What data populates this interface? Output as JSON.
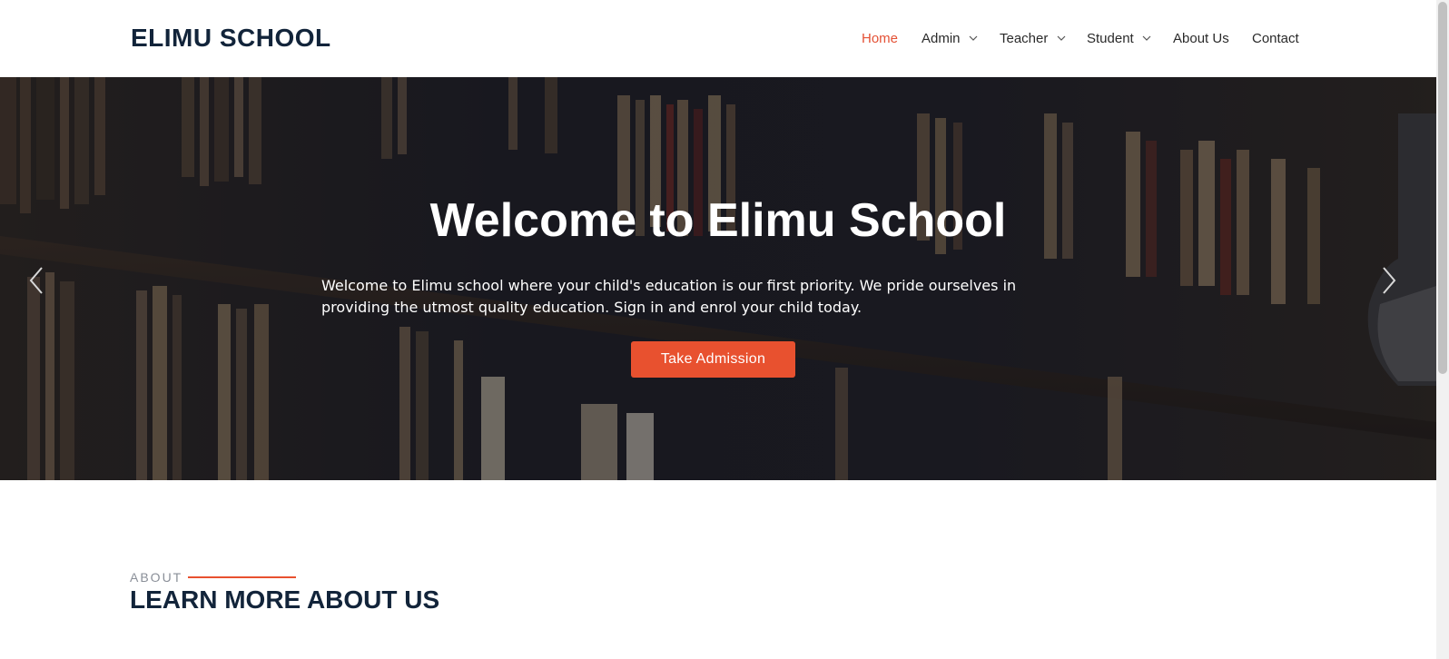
{
  "brand": {
    "name": "ELIMU SCHOOL"
  },
  "nav": {
    "items": [
      {
        "label": "Home",
        "active": true,
        "dropdown": false
      },
      {
        "label": "Admin",
        "active": false,
        "dropdown": true
      },
      {
        "label": "Teacher",
        "active": false,
        "dropdown": true
      },
      {
        "label": "Student",
        "active": false,
        "dropdown": true
      },
      {
        "label": "About Us",
        "active": false,
        "dropdown": false
      },
      {
        "label": "Contact",
        "active": false,
        "dropdown": false
      }
    ]
  },
  "hero": {
    "title": "Welcome to Elimu School",
    "text": "Welcome to Elimu school where your child's education is our first priority. We pride ourselves in providing the utmost quality education. Sign in and enrol your child today.",
    "button": "Take Admission",
    "prev_icon": "chevron-left-icon",
    "next_icon": "chevron-right-icon"
  },
  "about": {
    "label": "ABOUT",
    "title": "LEARN MORE ABOUT US"
  },
  "colors": {
    "accent": "#e8512f",
    "navy": "#12243a"
  }
}
